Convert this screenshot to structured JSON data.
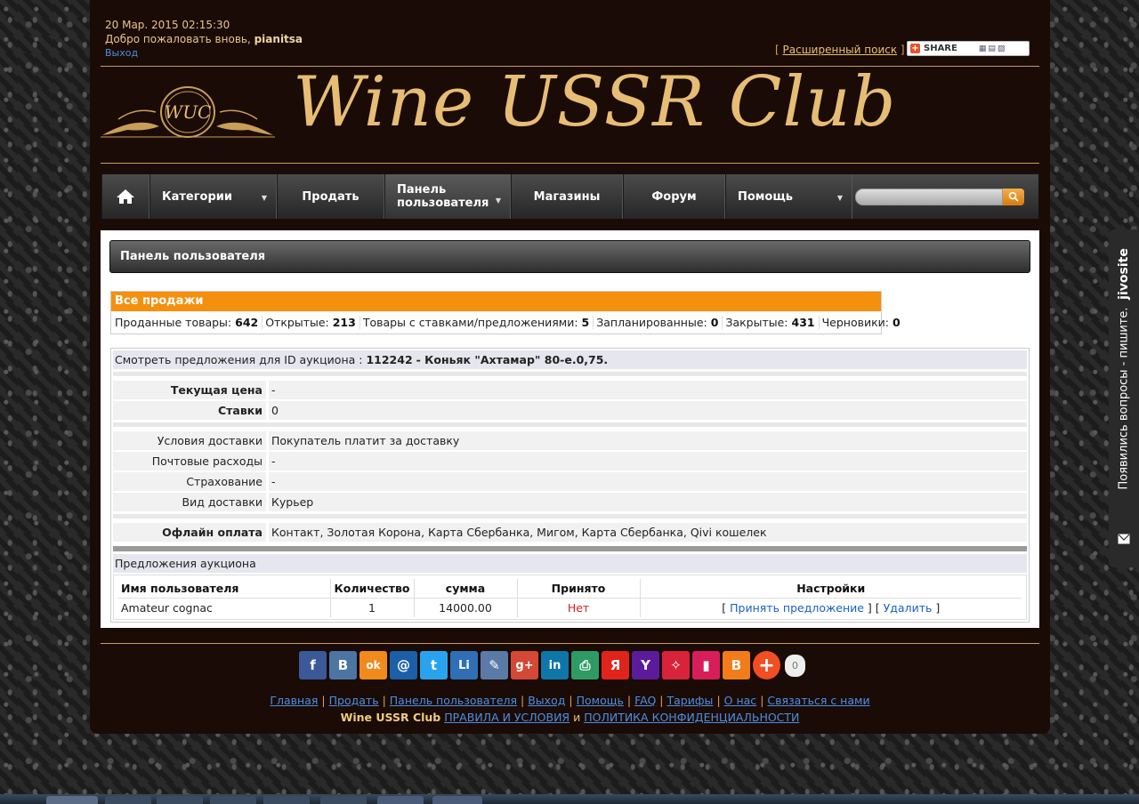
{
  "header": {
    "datetime": "20 Мар. 2015 02:15:30",
    "welcome_prefix": "Добро пожаловать вновь, ",
    "username": "pianitsa",
    "logout": "Выход",
    "advanced_search": "Расширенный поиск",
    "share_label": "SHARE",
    "bracket_open": "[",
    "bracket_close": "]"
  },
  "logo": {
    "emblem_text": "WUC",
    "title": "Wine USSR Club"
  },
  "nav": {
    "home_icon": "home-icon",
    "items": [
      {
        "label": "Категории"
      },
      {
        "label": "Продать"
      },
      {
        "label": "Панель пользователя"
      },
      {
        "label": "Магазины"
      },
      {
        "label": "Форум"
      },
      {
        "label": "Помощь"
      }
    ],
    "search_placeholder": ""
  },
  "panel_title": "Панель пользователя",
  "sales": {
    "header": "Все продажи",
    "stats": [
      {
        "label": "Проданные товары:",
        "value": "642"
      },
      {
        "label": "Открытые:",
        "value": "213"
      },
      {
        "label": "Товары с ставками/предложениями:",
        "value": "5"
      },
      {
        "label": "Запланированные:",
        "value": "0"
      },
      {
        "label": "Закрытые:",
        "value": "431"
      },
      {
        "label": "Черновики:",
        "value": "0"
      }
    ]
  },
  "offers": {
    "caption_prefix": "Смотреть предложения для ID аукциона :",
    "auction_id": "112242",
    "auction_title": "- Коньяк \"Ахтамар\" 80-е.0,75.",
    "current_price_label": "Текущая цена",
    "current_price": "-",
    "bids_label": "Ставки",
    "bids": "0",
    "shipping_terms_label": "Условия доставки",
    "shipping_terms": "Покупатель платит за доставку",
    "postage_label": "Почтовые расходы",
    "postage": "-",
    "insurance_label": "Страхование",
    "insurance": "-",
    "delivery_label": "Вид доставки",
    "delivery": "Курьер",
    "offline_payment_label": "Офлайн оплата",
    "offline_payment": "Контакт, Золотая Корона, Карта Сбербанка, Мигом, Карта Сбербанка, Qivi кошелек",
    "auction_offers_title": "Предложения аукциона",
    "columns": [
      "Имя пользователя",
      "Количество",
      "сумма",
      "Принято",
      "Настройки"
    ],
    "rows": [
      {
        "user": "Amateur cognac",
        "qty": "1",
        "amount": "14000.00",
        "accepted": "Нет",
        "accept_action": "Принять предложение",
        "delete_action": "Удалить"
      }
    ]
  },
  "social": {
    "icons": [
      {
        "name": "facebook-icon",
        "glyph": "f",
        "color": "#3b5998"
      },
      {
        "name": "vkontakte-icon",
        "glyph": "B",
        "color": "#4c75a3"
      },
      {
        "name": "odnoklassniki-icon",
        "glyph": "ok",
        "color": "#f08a1c"
      },
      {
        "name": "mail-icon",
        "glyph": "@",
        "color": "#1a5fa8"
      },
      {
        "name": "twitter-icon",
        "glyph": "t",
        "color": "#2aa3ef"
      },
      {
        "name": "liveinternet-icon",
        "glyph": "Li",
        "color": "#2f6fb5"
      },
      {
        "name": "livejournal-icon",
        "glyph": "✎",
        "color": "#5a7aa8"
      },
      {
        "name": "google-plus-icon",
        "glyph": "g+",
        "color": "#d34836"
      },
      {
        "name": "linkedin-icon",
        "glyph": "in",
        "color": "#0e76a8"
      },
      {
        "name": "print-icon",
        "glyph": "⎙",
        "color": "#2f9b64"
      },
      {
        "name": "yandex-icon",
        "glyph": "Я",
        "color": "#e0231b"
      },
      {
        "name": "yahoo-icon",
        "glyph": "Y",
        "color": "#5c1b9a"
      },
      {
        "name": "surfingbird-icon",
        "glyph": "✧",
        "color": "#d8233b"
      },
      {
        "name": "bookmark-icon",
        "glyph": "▮",
        "color": "#d81e5a"
      },
      {
        "name": "blogger-icon",
        "glyph": "B",
        "color": "#f27c1a"
      },
      {
        "name": "more-plus-icon",
        "glyph": "+",
        "color": "#f04e23"
      }
    ],
    "count": "0"
  },
  "footer": {
    "links": [
      "Главная",
      "Продать",
      "Панель пользователя",
      "Выход",
      "Помощь",
      "FAQ",
      "Тарифы",
      "О нас",
      "Связаться с нами"
    ],
    "site_name": "Wine USSR Club",
    "terms": "ПРАВИЛА И УСЛОВИЯ",
    "and": "и",
    "privacy": "ПОЛИТИКА КОНФИДЕНЦИАЛЬНОСТИ"
  },
  "jivo": {
    "brand": "jivosite",
    "text": "Появились вопросы - пишите."
  }
}
